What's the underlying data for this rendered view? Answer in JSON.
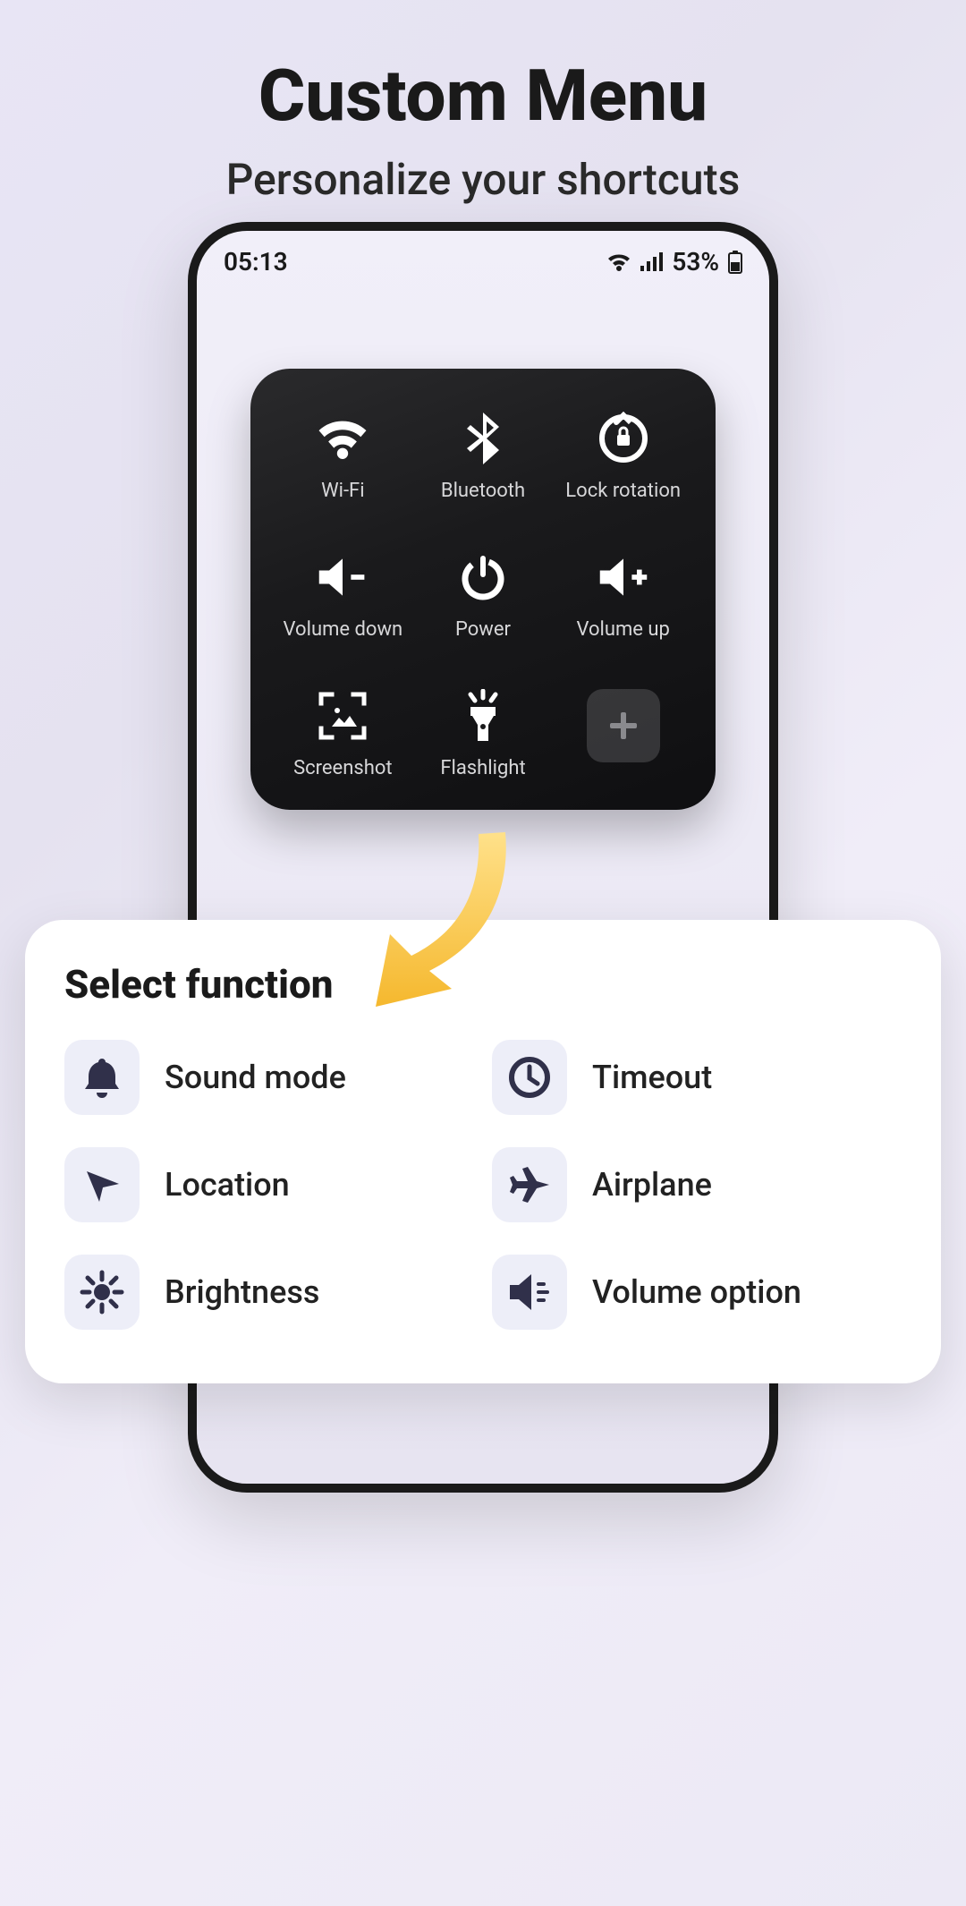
{
  "header": {
    "title": "Custom Menu",
    "subtitle": "Personalize your shortcuts"
  },
  "statusbar": {
    "time": "05:13",
    "battery_pct": "53%"
  },
  "panel": {
    "items": [
      {
        "icon": "wifi-icon",
        "label": "Wi-Fi"
      },
      {
        "icon": "bluetooth-icon",
        "label": "Bluetooth"
      },
      {
        "icon": "lock-rotation-icon",
        "label": "Lock rotation"
      },
      {
        "icon": "volume-down-icon",
        "label": "Volume down"
      },
      {
        "icon": "power-icon",
        "label": "Power"
      },
      {
        "icon": "volume-up-icon",
        "label": "Volume up"
      },
      {
        "icon": "screenshot-icon",
        "label": "Screenshot"
      },
      {
        "icon": "flashlight-icon",
        "label": "Flashlight"
      }
    ],
    "add_label": "+"
  },
  "select": {
    "title": "Select function",
    "items": [
      {
        "icon": "bell-icon",
        "label": "Sound mode"
      },
      {
        "icon": "clock-icon",
        "label": "Timeout"
      },
      {
        "icon": "location-icon",
        "label": "Location"
      },
      {
        "icon": "airplane-icon",
        "label": "Airplane"
      },
      {
        "icon": "brightness-icon",
        "label": "Brightness"
      },
      {
        "icon": "volume-option-icon",
        "label": "Volume option"
      }
    ]
  },
  "colors": {
    "accent_dark": "#30304a",
    "arrow": "#f7c948"
  }
}
